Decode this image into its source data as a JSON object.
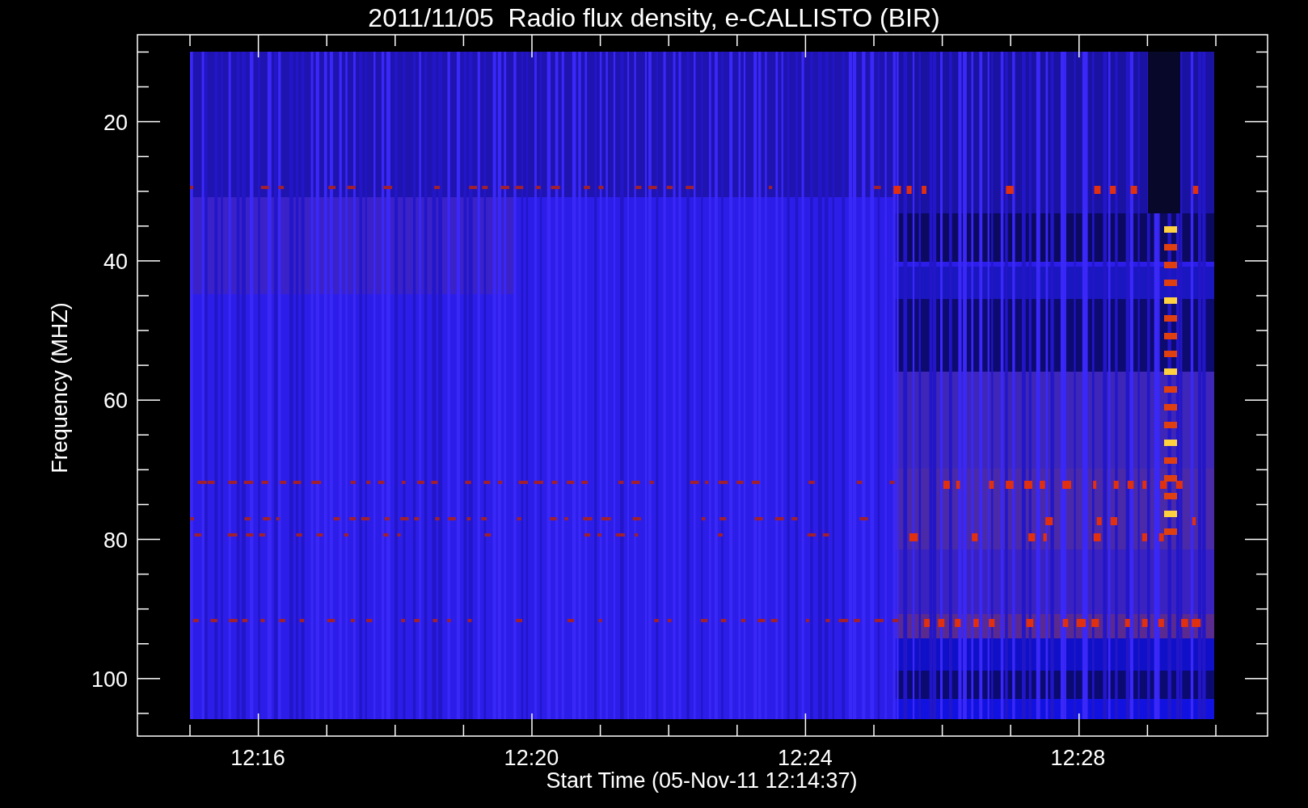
{
  "title": "2011/11/05  Radio flux density, e-CALLISTO (BIR)",
  "y_axis": {
    "label": "Frequency (MHZ)",
    "ticks": [
      "20",
      "40",
      "60",
      "80",
      "100"
    ]
  },
  "x_axis": {
    "label": "Start Time (05-Nov-11 12:14:37)",
    "ticks": [
      "12:16",
      "12:20",
      "12:24",
      "12:28"
    ]
  }
}
